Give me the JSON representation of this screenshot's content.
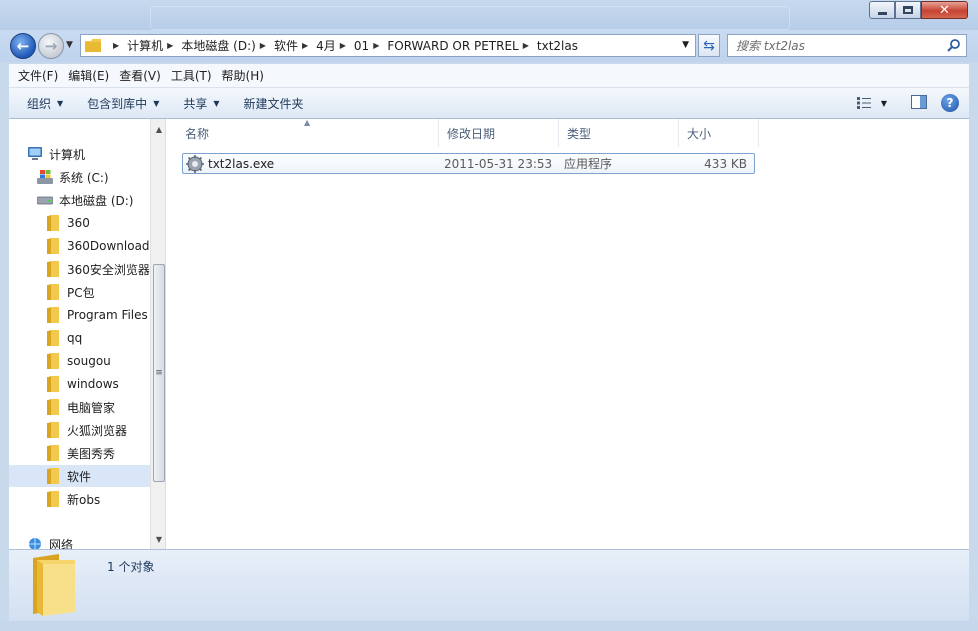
{
  "window": {
    "controls": {
      "minimize": "minimize",
      "maximize": "maximize",
      "close": "close"
    }
  },
  "address_bar": {
    "breadcrumbs": [
      "计算机",
      "本地磁盘 (D:)",
      "软件",
      "4月",
      "01",
      "FORWARD OR PETREL",
      "txt2las"
    ]
  },
  "search": {
    "placeholder": "搜索 txt2las"
  },
  "menu": {
    "items": [
      "文件(F)",
      "编辑(E)",
      "查看(V)",
      "工具(T)",
      "帮助(H)"
    ]
  },
  "toolbar": {
    "organize": "组织",
    "include_in_library": "包含到库中",
    "share": "共享",
    "new_folder": "新建文件夹"
  },
  "nav_tree": {
    "computer": "计算机",
    "drive_c": "系统 (C:)",
    "drive_d": "本地磁盘 (D:)",
    "folders": [
      "360",
      "360Download",
      "360安全浏览器",
      "PC包",
      "Program Files",
      "qq",
      "sougou",
      "windows",
      "电脑管家",
      "火狐浏览器",
      "美图秀秀",
      "软件",
      "新obs"
    ],
    "selected_folder": "软件",
    "network": "网络"
  },
  "columns": {
    "name": "名称",
    "date": "修改日期",
    "type": "类型",
    "size": "大小"
  },
  "files": [
    {
      "name": "txt2las.exe",
      "date": "2011-05-31 23:53",
      "type": "应用程序",
      "size": "433 KB"
    }
  ],
  "details": {
    "count": "1 个对象"
  },
  "colors": {
    "accent": "#1e58b8",
    "selection": "#d9e6f7",
    "frame": "#c9d9ec"
  },
  "icons": {
    "back": "back-arrow-icon",
    "forward": "forward-arrow-icon",
    "refresh": "refresh-icon",
    "search": "search-icon",
    "folder": "folder-icon",
    "exe": "gear-exe-icon",
    "computer": "computer-icon",
    "drive": "hard-drive-icon",
    "network": "network-icon",
    "help": "help-icon",
    "view": "view-options-icon",
    "preview": "preview-pane-icon"
  }
}
